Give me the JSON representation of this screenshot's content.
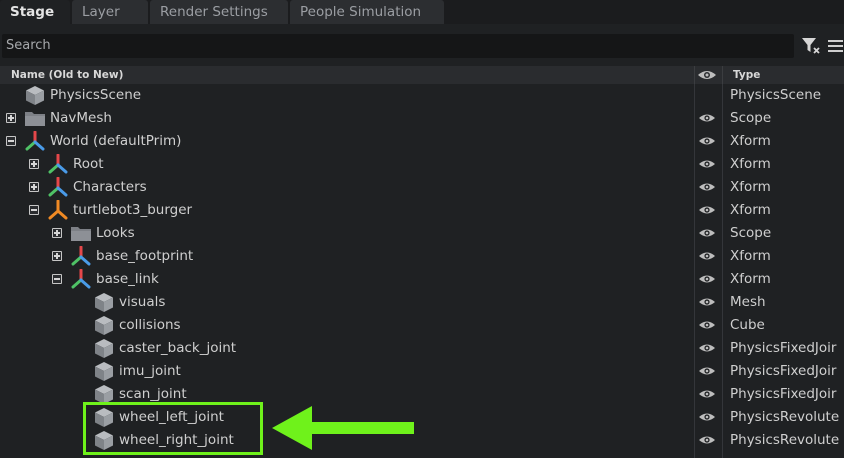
{
  "tabs": [
    {
      "label": "Stage",
      "active": true
    },
    {
      "label": "Layer",
      "active": false
    },
    {
      "label": "Render Settings",
      "active": false
    },
    {
      "label": "People Simulation",
      "active": false
    }
  ],
  "search": {
    "placeholder": "Search"
  },
  "header": {
    "name": "Name (Old to New)",
    "type": "Type",
    "visibility_icon": "eye-icon"
  },
  "rows": [
    {
      "name": "PhysicsScene",
      "type": "PhysicsScene",
      "icon": "cube-icon",
      "expander": "none",
      "visible": false
    },
    {
      "name": "NavMesh",
      "type": "Scope",
      "icon": "folder-icon",
      "expander": "plus",
      "visible": true
    },
    {
      "name": "World (defaultPrim)",
      "type": "Xform",
      "icon": "xform-icon",
      "expander": "minus",
      "visible": true
    },
    {
      "name": "Root",
      "type": "Xform",
      "icon": "xform-icon",
      "expander": "plus",
      "visible": true
    },
    {
      "name": "Characters",
      "type": "Xform",
      "icon": "xform-icon",
      "expander": "plus",
      "visible": true
    },
    {
      "name": "turtlebot3_burger",
      "type": "Xform",
      "icon": "xform-orange-icon",
      "expander": "minus",
      "visible": true
    },
    {
      "name": "Looks",
      "type": "Scope",
      "icon": "folder-icon",
      "expander": "plus",
      "visible": true
    },
    {
      "name": "base_footprint",
      "type": "Xform",
      "icon": "xform-icon",
      "expander": "plus",
      "visible": true
    },
    {
      "name": "base_link",
      "type": "Xform",
      "icon": "xform-icon",
      "expander": "minus",
      "visible": true
    },
    {
      "name": "visuals",
      "type": "Mesh",
      "icon": "cube-icon",
      "expander": "none",
      "visible": true
    },
    {
      "name": "collisions",
      "type": "Cube",
      "icon": "cube-icon",
      "expander": "none",
      "visible": true
    },
    {
      "name": "caster_back_joint",
      "type": "PhysicsFixedJoir",
      "icon": "cube-icon",
      "expander": "none",
      "visible": true
    },
    {
      "name": "imu_joint",
      "type": "PhysicsFixedJoir",
      "icon": "cube-icon",
      "expander": "none",
      "visible": true
    },
    {
      "name": "scan_joint",
      "type": "PhysicsFixedJoir",
      "icon": "cube-icon",
      "expander": "none",
      "visible": true
    },
    {
      "name": "wheel_left_joint",
      "type": "PhysicsRevolute",
      "icon": "cube-icon",
      "expander": "none",
      "visible": true
    },
    {
      "name": "wheel_right_joint",
      "type": "PhysicsRevolute",
      "icon": "cube-icon",
      "expander": "none",
      "visible": true
    }
  ],
  "colors": {
    "highlight": "#6ff21b",
    "background": "#1f2123",
    "text": "#cfcfcf",
    "xform_red": "#e5474a",
    "xform_green": "#4fc266",
    "xform_blue": "#4a9be8",
    "xform_orange": "#f08a24"
  }
}
